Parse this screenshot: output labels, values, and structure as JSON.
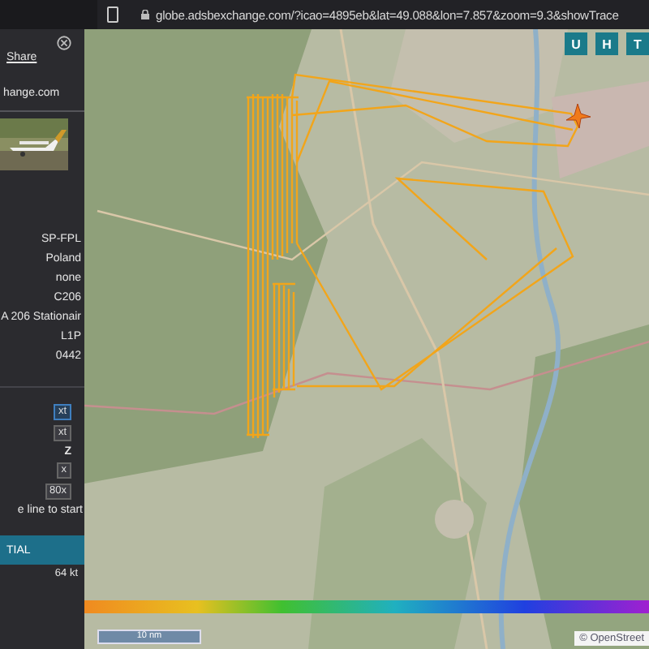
{
  "browser": {
    "url": "globe.adsbexchange.com/?icao=4895eb&lat=49.088&lon=7.857&zoom=9.3&showTrace"
  },
  "sidebar": {
    "share": "Share",
    "link": "hange.com",
    "details": [
      "SP-FPL",
      "Poland",
      "none",
      "C206",
      "A 206 Stationair",
      "L1P",
      "0442"
    ],
    "controls": [
      {
        "kind": "button",
        "label": "xt",
        "selected": true
      },
      {
        "kind": "button",
        "label": "xt",
        "selected": false
      },
      {
        "kind": "text",
        "label": "Z"
      },
      {
        "kind": "button",
        "label": "x",
        "selected": false
      },
      {
        "kind": "button",
        "label": "80x",
        "selected": false
      },
      {
        "kind": "text",
        "label": "e line to start"
      }
    ],
    "status": "TIAL",
    "speed": "64 kt"
  },
  "map": {
    "layer_buttons": [
      "U",
      "H",
      "T"
    ],
    "scale": "10 nm",
    "attribution": "© OpenStreet"
  }
}
